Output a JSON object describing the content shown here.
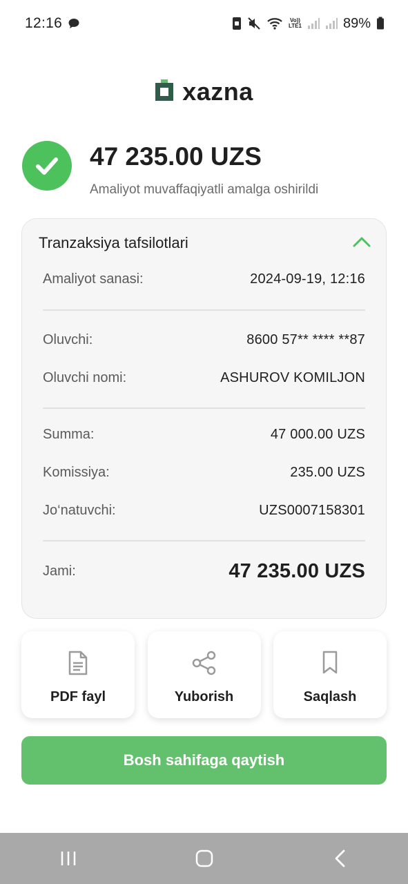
{
  "status_bar": {
    "time": "12:16",
    "lte_top": "Vo))",
    "lte_bottom": "LTE1",
    "battery": "89%"
  },
  "logo": {
    "text": "xazna"
  },
  "success": {
    "amount": "47 235.00 UZS",
    "message": "Amaliyot muvaffaqiyatli amalga oshirildi"
  },
  "details": {
    "title": "Tranzaksiya tafsilotlari",
    "rows": [
      {
        "label": "Amaliyot sanasi:",
        "value": "2024-09-19, 12:16"
      },
      {
        "label": "Oluvchi:",
        "value": "8600 57** **** **87"
      },
      {
        "label": "Oluvchi nomi:",
        "value": "ASHUROV KOMILJON"
      },
      {
        "label": "Summa:",
        "value": "47 000.00 UZS"
      },
      {
        "label": "Komissiya:",
        "value": "235.00 UZS"
      },
      {
        "label": "Jo‘natuvchi:",
        "value": "UZS0007158301"
      },
      {
        "label": "Jami:",
        "value": "47 235.00 UZS"
      }
    ]
  },
  "actions": [
    {
      "label": "PDF fayl",
      "icon": "document-icon"
    },
    {
      "label": "Yuborish",
      "icon": "share-icon"
    },
    {
      "label": "Saqlash",
      "icon": "bookmark-icon"
    }
  ],
  "primary_button": {
    "label": "Bosh sahifaga qaytish"
  },
  "colors": {
    "accent_green": "#63c16d",
    "check_green": "#4cc15c",
    "logo_green": "#2f5d4a"
  }
}
